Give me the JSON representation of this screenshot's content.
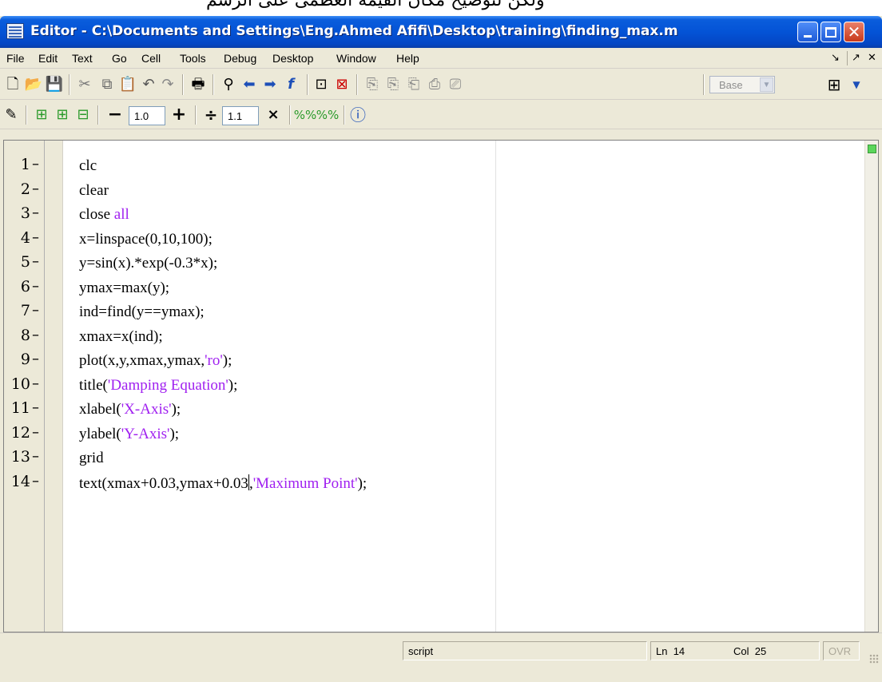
{
  "top_clipped_text": "ولكن لتوضيح مكان القيمة العظمى على الرسم",
  "window": {
    "title": "Editor - C:\\Documents and Settings\\Eng.Ahmed Afifi\\Desktop\\training\\finding_max.m"
  },
  "menu": {
    "items": [
      "File",
      "Edit",
      "Text",
      "Go",
      "Cell",
      "Tools",
      "Debug",
      "Desktop",
      "Window",
      "Help"
    ],
    "undock_icon": "undock-arrow-icon",
    "maximize_icon": "expand-arrow-icon",
    "close_icon": "close-x-icon"
  },
  "toolbar": {
    "stack_value": "Base",
    "layout_icon": "tile-grid-icon"
  },
  "cell_toolbar": {
    "decrement_symbol": "−",
    "increment_value": "1.0",
    "increment_symbol": "+",
    "divide_symbol": "÷",
    "multiply_value": "1.1",
    "multiply_symbol": "×"
  },
  "editor": {
    "lines": [
      {
        "num": "1",
        "parts": [
          {
            "t": "clc",
            "s": false
          }
        ]
      },
      {
        "num": "2",
        "parts": [
          {
            "t": "clear",
            "s": false
          }
        ]
      },
      {
        "num": "3",
        "parts": [
          {
            "t": "close ",
            "s": false
          },
          {
            "t": "all",
            "s": true
          }
        ]
      },
      {
        "num": "4",
        "parts": [
          {
            "t": "x=linspace(0,10,100);",
            "s": false
          }
        ]
      },
      {
        "num": "5",
        "parts": [
          {
            "t": "y=sin(x).*exp(-0.3*x);",
            "s": false
          }
        ]
      },
      {
        "num": "6",
        "parts": [
          {
            "t": "ymax=max(y);",
            "s": false
          }
        ]
      },
      {
        "num": "7",
        "parts": [
          {
            "t": "ind=find(y==ymax);",
            "s": false
          }
        ]
      },
      {
        "num": "8",
        "parts": [
          {
            "t": "xmax=x(ind);",
            "s": false
          }
        ]
      },
      {
        "num": "9",
        "parts": [
          {
            "t": "plot(x,y,xmax,ymax,",
            "s": false
          },
          {
            "t": "'ro'",
            "s": true
          },
          {
            "t": ");",
            "s": false
          }
        ]
      },
      {
        "num": "10",
        "parts": [
          {
            "t": "title(",
            "s": false
          },
          {
            "t": "'Damping Equation'",
            "s": true
          },
          {
            "t": ");",
            "s": false
          }
        ]
      },
      {
        "num": "11",
        "parts": [
          {
            "t": "xlabel(",
            "s": false
          },
          {
            "t": "'X-Axis'",
            "s": true
          },
          {
            "t": ");",
            "s": false
          }
        ]
      },
      {
        "num": "12",
        "parts": [
          {
            "t": "ylabel(",
            "s": false
          },
          {
            "t": "'Y-Axis'",
            "s": true
          },
          {
            "t": ");",
            "s": false
          }
        ]
      },
      {
        "num": "13",
        "parts": [
          {
            "t": "grid",
            "s": false
          }
        ]
      },
      {
        "num": "14",
        "parts": [
          {
            "t": "text(xmax+0.03,ymax+0.03",
            "s": false
          },
          {
            "t": "|",
            "s": false,
            "cursor": true
          },
          {
            "t": ",",
            "s": false
          },
          {
            "t": "'Maximum Point'",
            "s": true
          },
          {
            "t": ");",
            "s": false
          }
        ]
      }
    ],
    "line_dash": "–"
  },
  "status": {
    "mode": "script",
    "ln_label": "Ln",
    "ln_value": "14",
    "col_label": "Col",
    "col_value": "25",
    "ovr": "OVR"
  },
  "colors": {
    "string": "#a020f0",
    "title_bar": "#0453d6",
    "chrome": "#ece9d8"
  }
}
